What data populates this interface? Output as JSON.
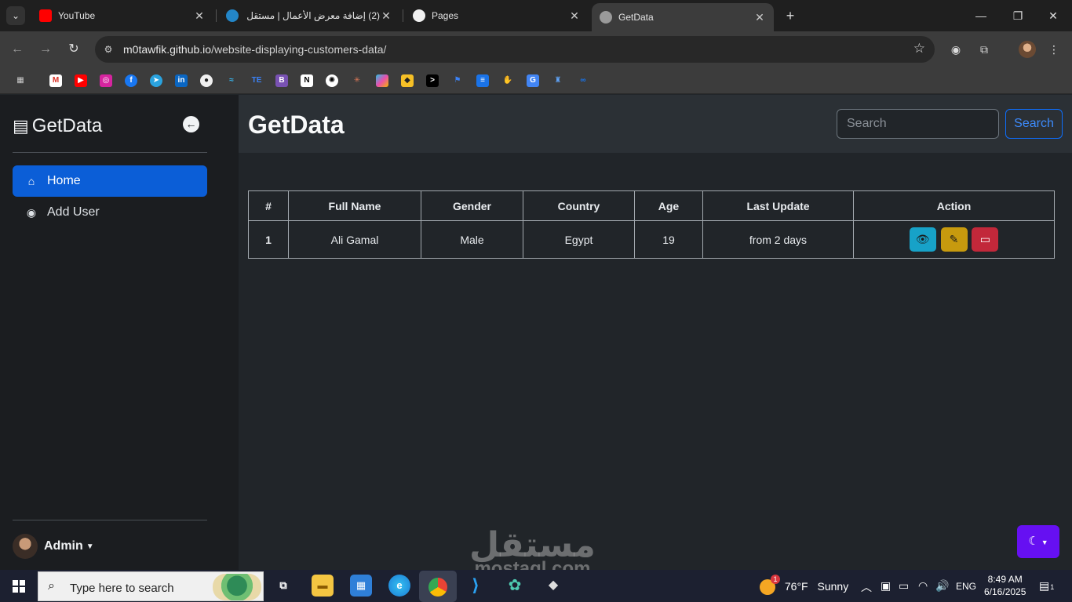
{
  "browser": {
    "tabs": [
      {
        "title": "YouTube",
        "icon": "youtube-icon"
      },
      {
        "title": "(2) إضافة معرض الأعمال | مستقل",
        "icon": "mostaql-icon",
        "badge": "2"
      },
      {
        "title": "Pages",
        "icon": "github-icon"
      },
      {
        "title": "GetData",
        "icon": "globe-icon"
      }
    ],
    "url_host": "m0tawfik.github.io",
    "url_path": "/website-displaying-customers-data/"
  },
  "sidebar": {
    "brand": "GetData",
    "items": [
      {
        "label": "Home",
        "active": true
      },
      {
        "label": "Add User",
        "active": false
      }
    ],
    "user_name": "Admin"
  },
  "header": {
    "title": "GetData",
    "search_placeholder": "Search",
    "search_button": "Search"
  },
  "table": {
    "columns": [
      "#",
      "Full Name",
      "Gender",
      "Country",
      "Age",
      "Last Update",
      "Action"
    ],
    "rows": [
      {
        "id": "1",
        "full_name": "Ali Gamal",
        "gender": "Male",
        "country": "Egypt",
        "age": "19",
        "last_update": "from 2 days"
      }
    ]
  },
  "watermark": {
    "arabic": "مستقل",
    "latin": "mostaql.com"
  },
  "taskbar": {
    "search_placeholder": "Type here to search",
    "weather_temp": "76°F",
    "weather_desc": "Sunny",
    "weather_badge": "1",
    "language": "ENG",
    "time": "8:49 AM",
    "date": "6/16/2025",
    "notification_count": "1"
  },
  "colors": {
    "primary": "#0b5ed7",
    "info": "#17a2c8",
    "warning": "#c79a0e",
    "danger": "#c2283a",
    "theme_toggle": "#6610f2"
  }
}
